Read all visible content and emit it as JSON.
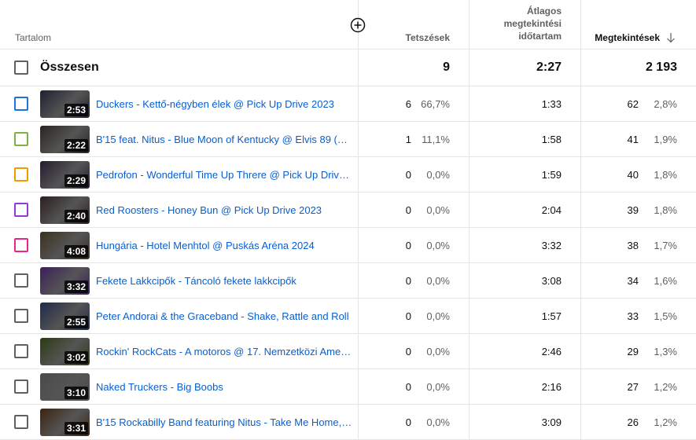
{
  "header": {
    "content": "Tartalom",
    "likes": "Tetszések",
    "avg_line1": "Átlagos",
    "avg_line2": "megtekintési",
    "avg_line3": "időtartam",
    "views": "Megtekintések"
  },
  "total": {
    "label": "Összesen",
    "likes": "9",
    "avg": "2:27",
    "views": "2 193"
  },
  "rows": [
    {
      "color": "#1a73e8",
      "duration": "2:53",
      "title": "Duckers - Kettő-négyben élek @ Pick Up Drive 2023",
      "likes": "6",
      "likes_pct": "66,7%",
      "avg": "1:33",
      "views": "62",
      "views_pct": "2,8%",
      "thumb": "#1c2230"
    },
    {
      "color": "#7cb342",
      "duration": "2:22",
      "title": "B'15 feat. Nitus - Blue Moon of Kentucky @ Elvis 89 (20…",
      "likes": "1",
      "likes_pct": "11,1%",
      "avg": "1:58",
      "views": "41",
      "views_pct": "1,9%",
      "thumb": "#2a2420"
    },
    {
      "color": "#f29900",
      "duration": "2:29",
      "title": "Pedrofon - Wonderful Time Up Threre @ Pick Up Drive …",
      "likes": "0",
      "likes_pct": "0,0%",
      "avg": "1:59",
      "views": "40",
      "views_pct": "1,8%",
      "thumb": "#251c2e"
    },
    {
      "color": "#9334e6",
      "duration": "2:40",
      "title": "Red Roosters - Honey Bun @ Pick Up Drive 2023",
      "likes": "0",
      "likes_pct": "0,0%",
      "avg": "2:04",
      "views": "39",
      "views_pct": "1,8%",
      "thumb": "#2b1f1f"
    },
    {
      "color": "#e52592",
      "duration": "4:08",
      "title": "Hungária - Hotel Menhtol @ Puskás Aréna 2024",
      "likes": "0",
      "likes_pct": "0,0%",
      "avg": "3:32",
      "views": "38",
      "views_pct": "1,7%",
      "thumb": "#3a3020"
    },
    {
      "color": "#606060",
      "duration": "3:32",
      "title": "Fekete Lakkcipők - Táncoló fekete lakkcipők",
      "likes": "0",
      "likes_pct": "0,0%",
      "avg": "3:08",
      "views": "34",
      "views_pct": "1,6%",
      "thumb": "#3a1f5a"
    },
    {
      "color": "#606060",
      "duration": "2:55",
      "title": "Peter Andorai & the Graceband - Shake, Rattle and Roll",
      "likes": "0",
      "likes_pct": "0,0%",
      "avg": "1:57",
      "views": "33",
      "views_pct": "1,5%",
      "thumb": "#1f2a4a"
    },
    {
      "color": "#606060",
      "duration": "3:02",
      "title": "Rockin' RockCats - A motoros @ 17. Nemzetközi Ameri…",
      "likes": "0",
      "likes_pct": "0,0%",
      "avg": "2:46",
      "views": "29",
      "views_pct": "1,3%",
      "thumb": "#2a3a14"
    },
    {
      "color": "#606060",
      "duration": "3:10",
      "title": "Naked Truckers - Big Boobs",
      "likes": "0",
      "likes_pct": "0,0%",
      "avg": "2:16",
      "views": "27",
      "views_pct": "1,2%",
      "thumb": "#4a4a4a"
    },
    {
      "color": "#606060",
      "duration": "3:31",
      "title": "B'15 Rockabilly Band featuring Nitus - Take Me Home, …",
      "likes": "0",
      "likes_pct": "0,0%",
      "avg": "3:09",
      "views": "26",
      "views_pct": "1,2%",
      "thumb": "#3a2410"
    }
  ]
}
